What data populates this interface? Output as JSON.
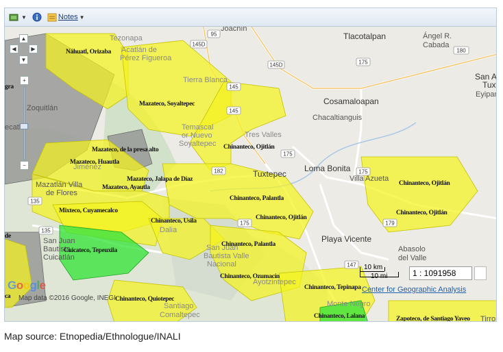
{
  "toolbar": {
    "layers_icon": "layers-icon",
    "info_icon": "info-icon",
    "notes_icon": "notes-icon",
    "notes_label": "Notes"
  },
  "map": {
    "places": {
      "joachin": "Joachín",
      "tlacotalpan": "Tlacotalpan",
      "angel_r_cabada_1": "Ángel R.",
      "angel_r_cabada_2": "Cabada",
      "tezonapa": "Tezonapa",
      "acatlan_1": "Acatlán de",
      "acatlan_2": "Pérez Figueroa",
      "tierra_blanca": "Tierra Blanca",
      "san_andres": "San A",
      "tuxtla": "Tuxt",
      "eyipantla": "Eyipant",
      "zoquitlan": "Zoquitlán",
      "cosamaloapan": "Cosamaloapan",
      "chacaltianguis": "Chacaltianguis",
      "temascal_1": "Temascal",
      "temascal_2": "or Nuevo",
      "temascal_3": "Soyaltepec",
      "tres_valles": "Tres Valles",
      "tuxtepec": "Tuxtepec",
      "loma_bonita": "Loma Bonita",
      "villa_azueta": "Villa Azueta",
      "mazatlan_1": "Mazatlán Villa",
      "mazatlan_2": "de Flores",
      "jimenez": "Jiménez",
      "dalia": "Dalia",
      "san_juan_1": "San Juan",
      "san_juan_2": "Bautista",
      "san_juan_3": "Cuicatlán",
      "sjbvn_1": "San Juan",
      "sjbvn_2": "Bautista Valle",
      "sjbvn_3": "Nacional",
      "ayotzintepec": "Ayotzintepec",
      "playa_vicente": "Playa Vicente",
      "abasolo_1": "Abasolo",
      "abasolo_2": "del Valle",
      "monte_negro": "Monte Negro",
      "santiago": "Santiago",
      "comaltepec": "Comaltepec",
      "ecatl": "ecatl",
      "xalapa_edge": "egra",
      "cuicatlan_edge": "ncahua",
      "tirror": "Tirror"
    },
    "roads": [
      "95",
      "145D",
      "180",
      "145D",
      "175",
      "145",
      "145",
      "175",
      "182",
      "175",
      "135",
      "135",
      "175",
      "147",
      "179"
    ],
    "languages": {
      "nahuatl_orizaba": "Náhuatl, Orizaba",
      "mazateco_soyaltepec": "Mazateco, Soyaltepec",
      "mazateco_presa_alto": "Mazateco, de la presa alto",
      "mazateco_huautla": "Mazateco, Huautla",
      "mazateco_jalapa": "Mazateco, Jalapa de Díaz",
      "mazateco_ayautla": "Mazateco, Ayautla",
      "chinanteco_ojitlan_1": "Chinanteco, Ojitlán",
      "chinanteco_ojitlan_2": "Chinanteco, Ojitlán",
      "chinanteco_ojitlan_3": "Chinanteco, Ojitlán",
      "chinanteco_ojitlan_4": "Chinanteco, Ojitlán",
      "chinanteco_palantla_1": "Chinanteco, Palantla",
      "chinanteco_palantla_2": "Chinanteco, Palantla",
      "chinanteco_usila": "Chinanteco, Usila",
      "mixteco_cuyamecalco": "Mixteco, Cuyamecalco",
      "cuicateco_tepeuxila": "Cuicateco, Tepeuxila",
      "chinanteco_ozumacin": "Chinanteco, Ozumacín",
      "chinanteco_tepinapa": "Chinanteco, Tepinapa",
      "chinanteco_quiotepec": "Chinanteco, Quiotepec",
      "chinanteco_lalana": "Chinanteco, Lalana",
      "zapoteco_yaveo": "Zapoteco, de Santiago Yaveo",
      "edge_ga": "gra",
      "edge_de": "de",
      "edge_ca": "ca"
    },
    "scale": {
      "km_label": "10 km",
      "mi_label": "10 mi",
      "ratio": "1 : 1091958"
    },
    "attribution_link": "Center for Geographic Analysis",
    "google_logo": "Google",
    "map_data": "Map data ©2016 Google, INEGI"
  },
  "nav": {
    "up": "▲",
    "down": "▼",
    "left": "◀",
    "right": "▶",
    "zoom_in": "+",
    "zoom_out": "−"
  },
  "colors": {
    "yellow": "#f4f21e",
    "gray": "#8f8f8f",
    "green": "#37e33a",
    "toolbar_text": "#1b3f7a"
  },
  "caption": "Map source: Etnopedia/Ethnologue/INALI"
}
